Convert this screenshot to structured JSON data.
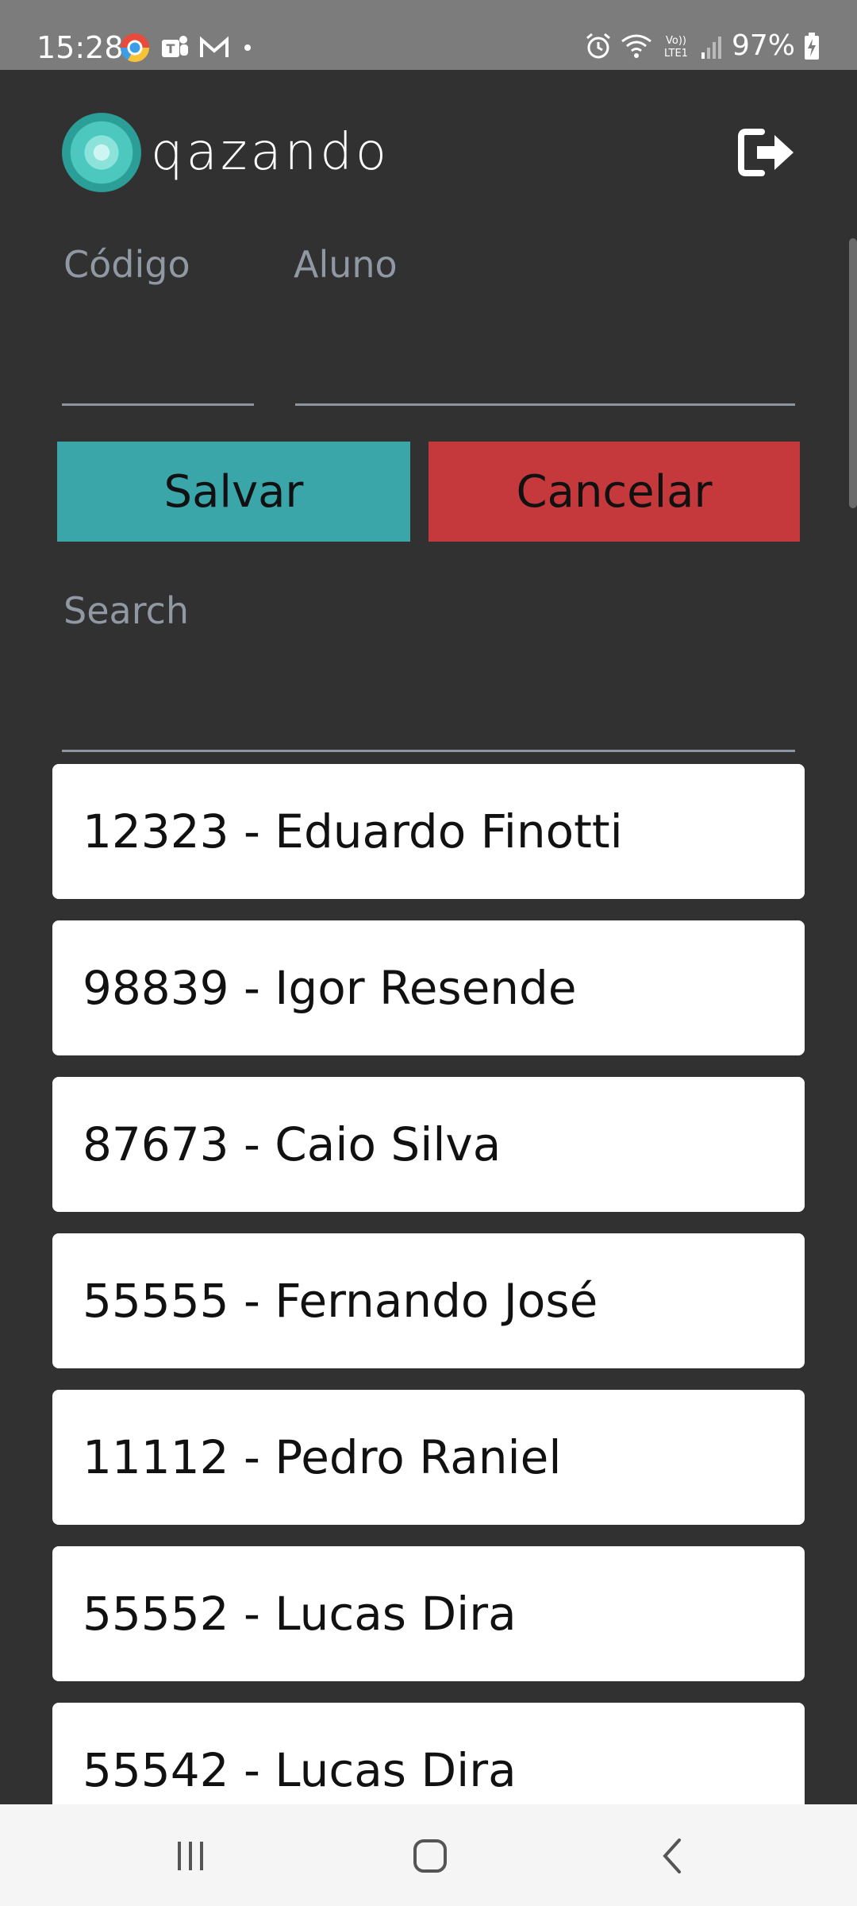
{
  "status_bar": {
    "time": "15:28",
    "battery": "97%",
    "icons_left": [
      "chrome-icon",
      "teams-icon",
      "gmail-icon",
      "dot-icon"
    ],
    "icons_right": [
      "alarm-icon",
      "wifi-icon",
      "volte-icon",
      "signal-icon",
      "battery-icon"
    ]
  },
  "header": {
    "logo_text": "qazando",
    "logout_icon": "logout-icon"
  },
  "form": {
    "code_label": "Código",
    "student_label": "Aluno",
    "code_value": "",
    "student_value": ""
  },
  "buttons": {
    "save": "Salvar",
    "cancel": "Cancelar"
  },
  "search": {
    "label": "Search",
    "value": ""
  },
  "students": [
    "12323 - Eduardo Finotti",
    "98839 - Igor Resende",
    "87673 - Caio Silva",
    "55555 - Fernando José",
    "11112 - Pedro Raniel",
    "55552 - Lucas Dira",
    "55542 - Lucas Dira"
  ],
  "colors": {
    "background": "#313131",
    "save_button": "#3aa6aa",
    "cancel_button": "#c5393c",
    "label": "#8f98a3"
  },
  "nav": [
    "recent-apps-icon",
    "home-icon",
    "back-icon"
  ]
}
